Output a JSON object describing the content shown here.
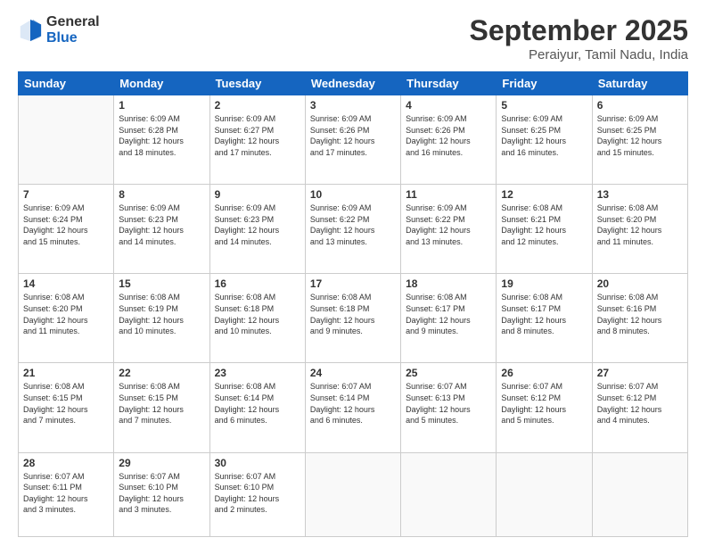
{
  "logo": {
    "line1": "General",
    "line2": "Blue"
  },
  "title": "September 2025",
  "subtitle": "Peraiyur, Tamil Nadu, India",
  "days": [
    "Sunday",
    "Monday",
    "Tuesday",
    "Wednesday",
    "Thursday",
    "Friday",
    "Saturday"
  ],
  "weeks": [
    [
      {
        "num": "",
        "info": ""
      },
      {
        "num": "1",
        "info": "Sunrise: 6:09 AM\nSunset: 6:28 PM\nDaylight: 12 hours\nand 18 minutes."
      },
      {
        "num": "2",
        "info": "Sunrise: 6:09 AM\nSunset: 6:27 PM\nDaylight: 12 hours\nand 17 minutes."
      },
      {
        "num": "3",
        "info": "Sunrise: 6:09 AM\nSunset: 6:26 PM\nDaylight: 12 hours\nand 17 minutes."
      },
      {
        "num": "4",
        "info": "Sunrise: 6:09 AM\nSunset: 6:26 PM\nDaylight: 12 hours\nand 16 minutes."
      },
      {
        "num": "5",
        "info": "Sunrise: 6:09 AM\nSunset: 6:25 PM\nDaylight: 12 hours\nand 16 minutes."
      },
      {
        "num": "6",
        "info": "Sunrise: 6:09 AM\nSunset: 6:25 PM\nDaylight: 12 hours\nand 15 minutes."
      }
    ],
    [
      {
        "num": "7",
        "info": "Sunrise: 6:09 AM\nSunset: 6:24 PM\nDaylight: 12 hours\nand 15 minutes."
      },
      {
        "num": "8",
        "info": "Sunrise: 6:09 AM\nSunset: 6:23 PM\nDaylight: 12 hours\nand 14 minutes."
      },
      {
        "num": "9",
        "info": "Sunrise: 6:09 AM\nSunset: 6:23 PM\nDaylight: 12 hours\nand 14 minutes."
      },
      {
        "num": "10",
        "info": "Sunrise: 6:09 AM\nSunset: 6:22 PM\nDaylight: 12 hours\nand 13 minutes."
      },
      {
        "num": "11",
        "info": "Sunrise: 6:09 AM\nSunset: 6:22 PM\nDaylight: 12 hours\nand 13 minutes."
      },
      {
        "num": "12",
        "info": "Sunrise: 6:08 AM\nSunset: 6:21 PM\nDaylight: 12 hours\nand 12 minutes."
      },
      {
        "num": "13",
        "info": "Sunrise: 6:08 AM\nSunset: 6:20 PM\nDaylight: 12 hours\nand 11 minutes."
      }
    ],
    [
      {
        "num": "14",
        "info": "Sunrise: 6:08 AM\nSunset: 6:20 PM\nDaylight: 12 hours\nand 11 minutes."
      },
      {
        "num": "15",
        "info": "Sunrise: 6:08 AM\nSunset: 6:19 PM\nDaylight: 12 hours\nand 10 minutes."
      },
      {
        "num": "16",
        "info": "Sunrise: 6:08 AM\nSunset: 6:18 PM\nDaylight: 12 hours\nand 10 minutes."
      },
      {
        "num": "17",
        "info": "Sunrise: 6:08 AM\nSunset: 6:18 PM\nDaylight: 12 hours\nand 9 minutes."
      },
      {
        "num": "18",
        "info": "Sunrise: 6:08 AM\nSunset: 6:17 PM\nDaylight: 12 hours\nand 9 minutes."
      },
      {
        "num": "19",
        "info": "Sunrise: 6:08 AM\nSunset: 6:17 PM\nDaylight: 12 hours\nand 8 minutes."
      },
      {
        "num": "20",
        "info": "Sunrise: 6:08 AM\nSunset: 6:16 PM\nDaylight: 12 hours\nand 8 minutes."
      }
    ],
    [
      {
        "num": "21",
        "info": "Sunrise: 6:08 AM\nSunset: 6:15 PM\nDaylight: 12 hours\nand 7 minutes."
      },
      {
        "num": "22",
        "info": "Sunrise: 6:08 AM\nSunset: 6:15 PM\nDaylight: 12 hours\nand 7 minutes."
      },
      {
        "num": "23",
        "info": "Sunrise: 6:08 AM\nSunset: 6:14 PM\nDaylight: 12 hours\nand 6 minutes."
      },
      {
        "num": "24",
        "info": "Sunrise: 6:07 AM\nSunset: 6:14 PM\nDaylight: 12 hours\nand 6 minutes."
      },
      {
        "num": "25",
        "info": "Sunrise: 6:07 AM\nSunset: 6:13 PM\nDaylight: 12 hours\nand 5 minutes."
      },
      {
        "num": "26",
        "info": "Sunrise: 6:07 AM\nSunset: 6:12 PM\nDaylight: 12 hours\nand 5 minutes."
      },
      {
        "num": "27",
        "info": "Sunrise: 6:07 AM\nSunset: 6:12 PM\nDaylight: 12 hours\nand 4 minutes."
      }
    ],
    [
      {
        "num": "28",
        "info": "Sunrise: 6:07 AM\nSunset: 6:11 PM\nDaylight: 12 hours\nand 3 minutes."
      },
      {
        "num": "29",
        "info": "Sunrise: 6:07 AM\nSunset: 6:10 PM\nDaylight: 12 hours\nand 3 minutes."
      },
      {
        "num": "30",
        "info": "Sunrise: 6:07 AM\nSunset: 6:10 PM\nDaylight: 12 hours\nand 2 minutes."
      },
      {
        "num": "",
        "info": ""
      },
      {
        "num": "",
        "info": ""
      },
      {
        "num": "",
        "info": ""
      },
      {
        "num": "",
        "info": ""
      }
    ]
  ]
}
